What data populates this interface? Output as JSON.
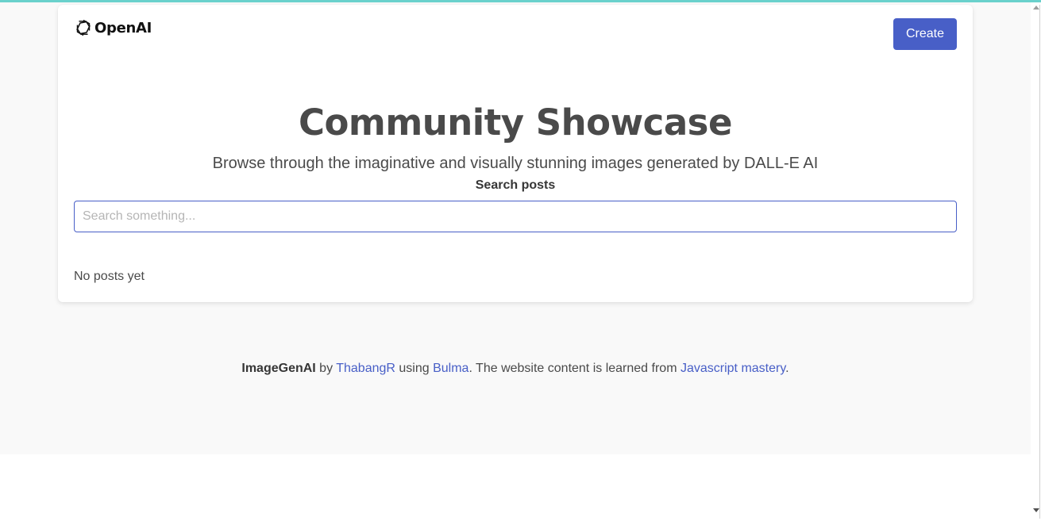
{
  "brand": {
    "logo_icon": "openai-logo-icon",
    "name": "OpenAI"
  },
  "header": {
    "create_label": "Create"
  },
  "hero": {
    "title": "Community Showcase",
    "subtitle": "Browse through the imaginative and visually stunning images generated by DALL-E AI"
  },
  "search": {
    "label": "Search posts",
    "placeholder": "Search something...",
    "value": ""
  },
  "posts": {
    "empty_text": "No posts yet"
  },
  "footer": {
    "app_name": "ImageGenAI",
    "by_text": " by ",
    "author_link": "ThabangR",
    "using_text": " using ",
    "framework_link": "Bulma",
    "learned_text": ". The website content is learned from ",
    "source_link": "Javascript mastery",
    "end_text": "."
  },
  "colors": {
    "accent": "#485fc7",
    "top_bar": "#6ad1cc",
    "page_bg": "#f9f9f9"
  }
}
